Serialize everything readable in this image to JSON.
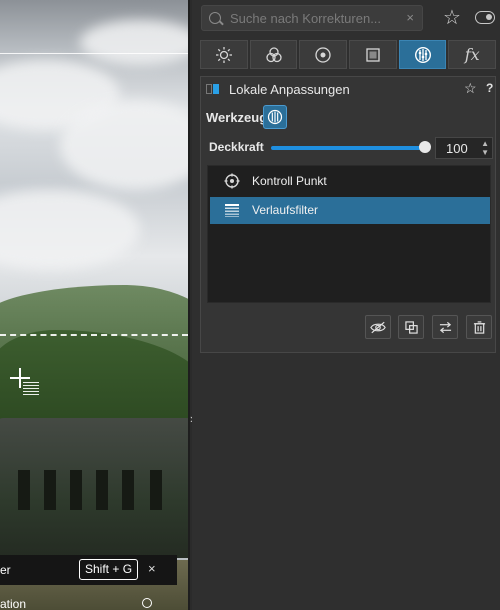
{
  "canvas": {
    "shortcut_bar": {
      "text": "er",
      "shortcut": "Shift + G",
      "close_glyph": "×"
    },
    "bottom_text": "ation",
    "collapse_glyph": "›"
  },
  "search": {
    "placeholder": "Suche nach Korrekturen...",
    "clear_glyph": "×"
  },
  "toolbar": {
    "star_glyph": "☆"
  },
  "tabs": [
    {
      "icon": "sun-icon"
    },
    {
      "icon": "color-circles-icon"
    },
    {
      "icon": "color-wheel-icon"
    },
    {
      "icon": "frame-icon"
    },
    {
      "icon": "local-adjust-icon",
      "active": true
    },
    {
      "icon": "fx-icon",
      "label": "fx"
    }
  ],
  "module": {
    "title": "Lokale Anpassungen",
    "star_glyph": "☆",
    "help_glyph": "?",
    "tool_label": "Werkzeug",
    "opacity_label": "Deckkraft",
    "opacity_value": "100",
    "opacity_fraction": 1.0,
    "items": [
      {
        "label": "Kontroll Punkt",
        "icon": "control-point-icon",
        "selected": false
      },
      {
        "label": "Verlaufsfilter",
        "icon": "gradient-filter-icon",
        "selected": true
      }
    ]
  },
  "colors": {
    "accent": "#2b6f99",
    "slider": "#1f8fe0"
  }
}
